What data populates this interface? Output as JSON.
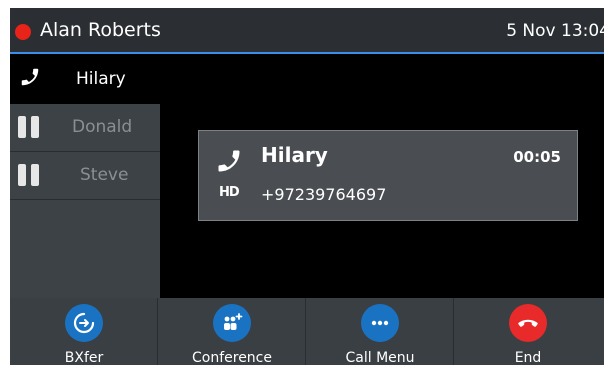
{
  "colors": {
    "status_red": "#e8231a",
    "accent_blue": "#1a73c2",
    "end_red": "#e82a2a",
    "divider_blue": "#3a8ee6"
  },
  "status_bar": {
    "user": "Alan Roberts",
    "datetime": "5 Nov 13:04"
  },
  "calls": {
    "active": {
      "name": "Hilary",
      "icon": "phone-icon"
    },
    "held": [
      {
        "name": "Donald",
        "icon": "pause-icon"
      },
      {
        "name": "Steve",
        "icon": "pause-icon"
      }
    ]
  },
  "call_card": {
    "name": "Hilary",
    "number": "+97239764697",
    "duration": "00:05",
    "hd_badge": "HD"
  },
  "softkeys": [
    {
      "label": "BXfer",
      "icon": "blind-transfer-icon"
    },
    {
      "label": "Conference",
      "icon": "conference-icon"
    },
    {
      "label": "Call Menu",
      "icon": "more-icon"
    },
    {
      "label": "End",
      "icon": "hang-up-icon"
    }
  ]
}
